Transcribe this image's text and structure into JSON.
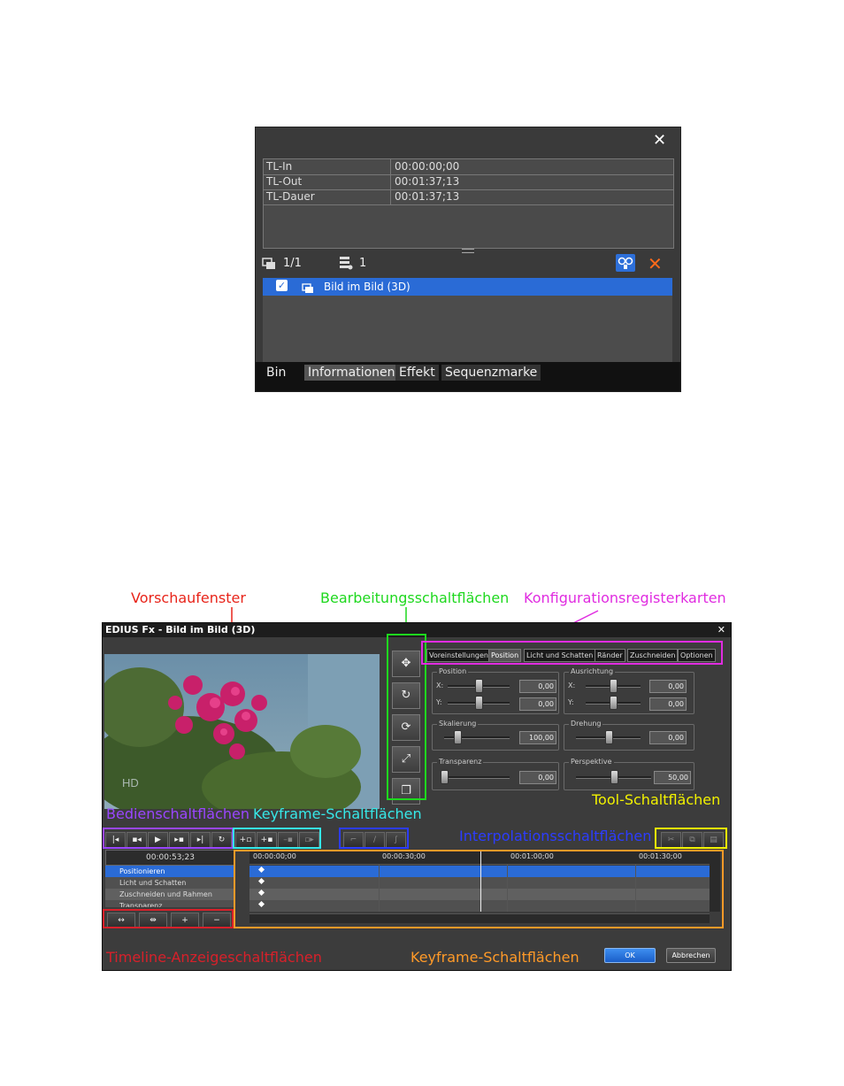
{
  "info_panel": {
    "close_glyph": "✕",
    "rows": [
      {
        "key": "TL-In",
        "value": "00:00:00;00"
      },
      {
        "key": "TL-Out",
        "value": "00:01:37;13"
      },
      {
        "key": "TL-Dauer",
        "value": "00:01:37;13"
      }
    ],
    "page_count": "1/1",
    "effect_count": "1",
    "effect_item": "Bild im Bild (3D)",
    "tabs": [
      "Bin",
      "Informationen",
      "Effekt",
      "Sequenzmarke"
    ]
  },
  "annotations": {
    "preview": "Vorschaufenster",
    "edit_buttons": "Bearbeitungsschaltflächen",
    "config_tabs": "Konfigurationsregisterkarten",
    "control_buttons": "Bedienschaltflächen",
    "keyframe_buttons_top": "Keyframe-Schaltflächen",
    "tool_buttons": "Tool-Schaltflächen",
    "interpolation_buttons": "Interpolationsschaltflächen",
    "timeline_buttons": "Timeline-Anzeigeschaltflächen",
    "keyframe_buttons_bottom": "Keyframe-Schaltflächen"
  },
  "dialog": {
    "title": "EDIUS Fx - Bild im Bild (3D)",
    "close_glyph": "✕",
    "tabs": [
      "Voreinstellungen",
      "Position",
      "Licht und Schatten",
      "Ränder",
      "Zuschneiden",
      "Optionen"
    ],
    "active_tab": "Position",
    "groups": {
      "position": {
        "label": "Position",
        "x_label": "X:",
        "y_label": "Y:",
        "x": "0,00",
        "y": "0,00",
        "x_level": 0.5,
        "y_level": 0.5
      },
      "alignment": {
        "label": "Ausrichtung",
        "x_label": "X:",
        "y_label": "Y:",
        "x": "0,00",
        "y": "0,00",
        "x_level": 0.5,
        "y_level": 0.5
      },
      "scale": {
        "label": "Skalierung",
        "value": "100,00",
        "level": 0.2
      },
      "rotation": {
        "label": "Drehung",
        "value": "0,00",
        "level": 0.5
      },
      "transparency": {
        "label": "Transparenz",
        "value": "0,00",
        "level": 0.0
      },
      "perspective": {
        "label": "Perspektive",
        "value": "50,00",
        "level": 0.5
      }
    },
    "timecode": "00:00:53;23",
    "ruler_ticks": [
      "00:00:00;00",
      "00:00:30;00",
      "00:01:00;00",
      "00:01:30;00"
    ],
    "tracks": [
      "Positionieren",
      "Licht und Schatten",
      "Zuschneiden und Rahmen",
      "Transparenz"
    ],
    "ok_label": "OK",
    "cancel_label": "Abbrechen",
    "watermark": "HD"
  }
}
